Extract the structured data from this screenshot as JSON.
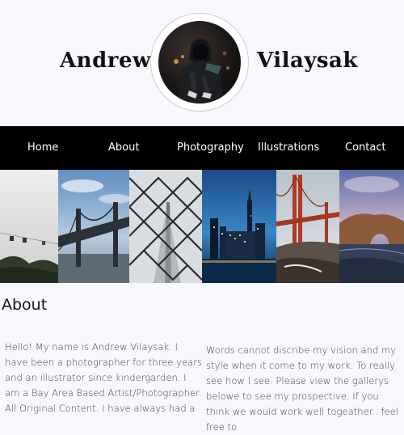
{
  "header": {
    "first_name": "Andrew",
    "last_name": "Vilaysak",
    "avatar_icon": "profile-photo"
  },
  "nav": {
    "items": [
      {
        "label": "Home"
      },
      {
        "label": "About"
      },
      {
        "label": "Photography"
      },
      {
        "label": "Illustrations"
      },
      {
        "label": "Contact"
      }
    ]
  },
  "gallery": {
    "photos": [
      {
        "icon": "foggy-gondola-photo"
      },
      {
        "icon": "bay-bridge-photo"
      },
      {
        "icon": "chain-fence-bridge-photo"
      },
      {
        "icon": "city-skyline-night-photo"
      },
      {
        "icon": "golden-gate-bridge-photo"
      },
      {
        "icon": "coastal-rock-arch-photo"
      }
    ]
  },
  "about": {
    "title": "About",
    "left_text": "Hello! My name is Andrew Vilaysak. I have been a photographer for three years and an illustrator since kindergarden. I am a Bay Area Based Artist/Photographer. All Original Content. I have always had a",
    "right_text": "Words cannot discribe my vision and my style when it come to my work. To really see how I see. Please view the gallerys belowe to see my prospective. If you think we would work well togeather.. feel free to"
  }
}
